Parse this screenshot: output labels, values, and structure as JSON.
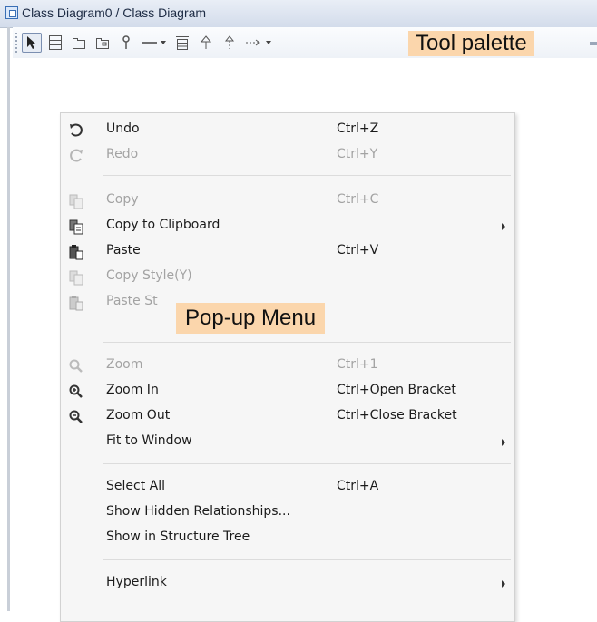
{
  "window": {
    "title": "Class Diagram0 / Class Diagram",
    "icon": "diagram-icon"
  },
  "toolbar": {
    "tools": [
      {
        "name": "select-tool",
        "icon": "pointer-arrow-icon",
        "selected": true
      },
      {
        "name": "class-tool",
        "icon": "class-box-icon"
      },
      {
        "name": "package-tool",
        "icon": "package-folder-icon"
      },
      {
        "name": "subsystem-tool",
        "icon": "subsystem-folder-icon"
      },
      {
        "name": "interface-tool",
        "icon": "lollipop-icon"
      },
      {
        "name": "association-tool",
        "icon": "line-dropdown-icon"
      },
      {
        "name": "class-template-tool",
        "icon": "template-box-icon"
      },
      {
        "name": "generalization-tool",
        "icon": "hollow-arrow-up-icon"
      },
      {
        "name": "realization-tool",
        "icon": "dashed-arrow-up-icon"
      },
      {
        "name": "dependency-tool",
        "icon": "dashed-arrow-right-dropdown-icon"
      }
    ],
    "callout": "Tool palette"
  },
  "popup_menu": {
    "callout": "Pop-up Menu",
    "items": [
      {
        "label": "Undo",
        "shortcut": "Ctrl+Z",
        "icon": "undo-icon",
        "enabled": true
      },
      {
        "label": "Redo",
        "shortcut": "Ctrl+Y",
        "icon": "redo-icon",
        "enabled": false
      },
      {
        "label": "Copy",
        "shortcut": "Ctrl+C",
        "icon": "copy-icon",
        "enabled": false
      },
      {
        "label": "Copy to Clipboard",
        "shortcut": "",
        "icon": "copy-clipboard-icon",
        "enabled": true,
        "submenu": true
      },
      {
        "label": "Paste",
        "shortcut": "Ctrl+V",
        "icon": "paste-icon",
        "enabled": true
      },
      {
        "label": "Copy Style(Y)",
        "shortcut": "",
        "icon": "copy-style-icon",
        "enabled": false
      },
      {
        "label": "Paste St",
        "shortcut": "",
        "icon": "paste-style-icon",
        "enabled": false
      },
      {
        "label": "Zoom",
        "shortcut": "Ctrl+1",
        "icon": "zoom-icon",
        "enabled": false
      },
      {
        "label": "Zoom In",
        "shortcut": "Ctrl+Open Bracket",
        "icon": "zoom-in-icon",
        "enabled": true
      },
      {
        "label": "Zoom Out",
        "shortcut": "Ctrl+Close Bracket",
        "icon": "zoom-out-icon",
        "enabled": true
      },
      {
        "label": "Fit to Window",
        "shortcut": "",
        "enabled": true,
        "submenu": true
      },
      {
        "label": "Select All",
        "shortcut": "Ctrl+A",
        "enabled": true
      },
      {
        "label": "Show Hidden Relationships...",
        "shortcut": "",
        "enabled": true
      },
      {
        "label": "Show in Structure Tree",
        "shortcut": "",
        "enabled": true
      },
      {
        "label": "Hyperlink",
        "shortcut": "",
        "enabled": true,
        "submenu": true
      }
    ]
  },
  "colors": {
    "callout_bg": "#fbd6ac",
    "menu_bg": "#f6f6f6",
    "disabled_text": "#a3a3a3"
  }
}
